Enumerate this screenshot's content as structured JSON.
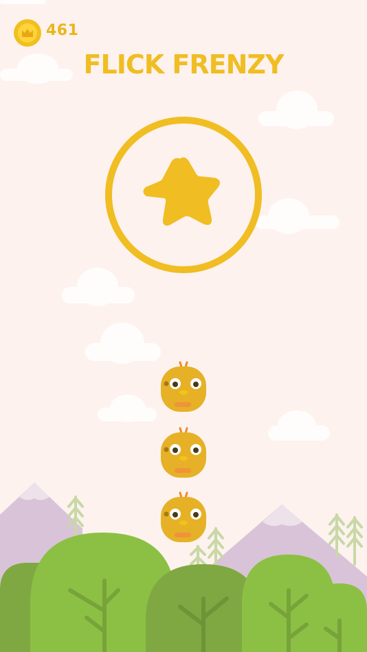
{
  "hud": {
    "coin_count": "461",
    "coin_icon": "crown-icon"
  },
  "game": {
    "title": "FLICK FRENZY",
    "play_button_icon": "star-icon"
  },
  "characters": [
    {
      "name": "chick"
    },
    {
      "name": "chick"
    },
    {
      "name": "chick"
    }
  ],
  "colors": {
    "background": "#fdf2ee",
    "accent_yellow": "#f0bd22",
    "chick_body": "#e6b126",
    "hill_green": "#8cc044",
    "hill_dark_green": "#7fa842",
    "mountain_purple": "#d9c3d8"
  }
}
